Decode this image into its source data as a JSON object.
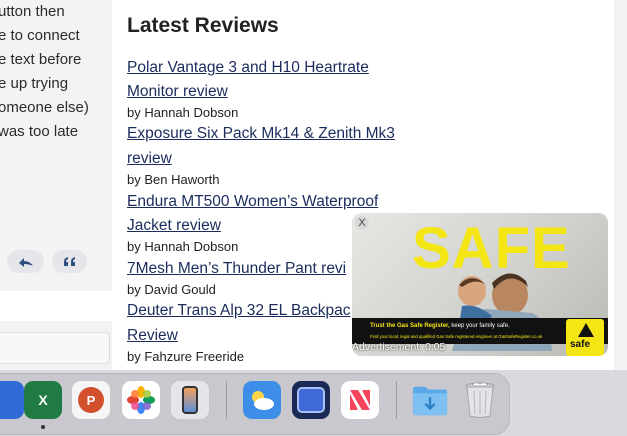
{
  "comment_fragment": {
    "lines": [
      "utton then",
      "e to connect",
      "e text before",
      "e up trying",
      "omeone else)",
      "was too late"
    ],
    "reply_icon": "reply-arrow-icon",
    "quote_icon": "quote-icon"
  },
  "reviews": {
    "title": "Latest Reviews",
    "items": [
      {
        "title_lines": [
          "Polar Vantage 3 and H10 Heartrate",
          "Monitor review"
        ],
        "author": "by Hannah Dobson"
      },
      {
        "title_lines": [
          "Exposure Six Pack Mk14 & Zenith Mk3",
          "review"
        ],
        "author": "by Ben Haworth"
      },
      {
        "title_lines": [
          "Endura MT500 Women’s Waterproof",
          "Jacket review"
        ],
        "author": "by Hannah Dobson"
      },
      {
        "title_lines": [
          "7Mesh Men’s Thunder Pant revi"
        ],
        "author": "by David Gould"
      },
      {
        "title_lines": [
          "Deuter Trans Alp 32 EL Backpac",
          "Review"
        ],
        "author": "by Fahzure Freeride"
      }
    ]
  },
  "ad": {
    "close_label": "X",
    "headline": "SAFE",
    "banner_prefix": "Trust the Gas Safe Register,",
    "banner_suffix": " keep your family safe.",
    "banner_sub": "Find your local, legal and qualified Gas Safe registered engineer at GasSafeRegister.co.uk",
    "logo_text": "safe",
    "timer": "Advertisement: 0:05",
    "accent_color": "#f4e514"
  },
  "dock": {
    "apps": [
      {
        "name": "Microsoft Excel",
        "icon": "excel-icon",
        "glyph": "X",
        "running": true
      },
      {
        "name": "Microsoft PowerPoint",
        "icon": "powerpoint-icon",
        "glyph": "P",
        "running": false
      },
      {
        "name": "Photos",
        "icon": "photos-icon",
        "glyph": "",
        "running": false
      },
      {
        "name": "iPhone Mirroring",
        "icon": "iphone-mirroring-icon",
        "glyph": "",
        "running": false
      },
      {
        "name": "Weather",
        "icon": "weather-icon",
        "glyph": "",
        "running": false
      },
      {
        "name": "Screen Sharing",
        "icon": "screen-sharing-icon",
        "glyph": "",
        "running": false
      },
      {
        "name": "News",
        "icon": "news-icon",
        "glyph": "",
        "running": false
      },
      {
        "name": "Downloads",
        "icon": "downloads-folder-icon",
        "glyph": "",
        "running": false
      },
      {
        "name": "Trash",
        "icon": "trash-icon",
        "glyph": "",
        "running": false
      }
    ]
  }
}
